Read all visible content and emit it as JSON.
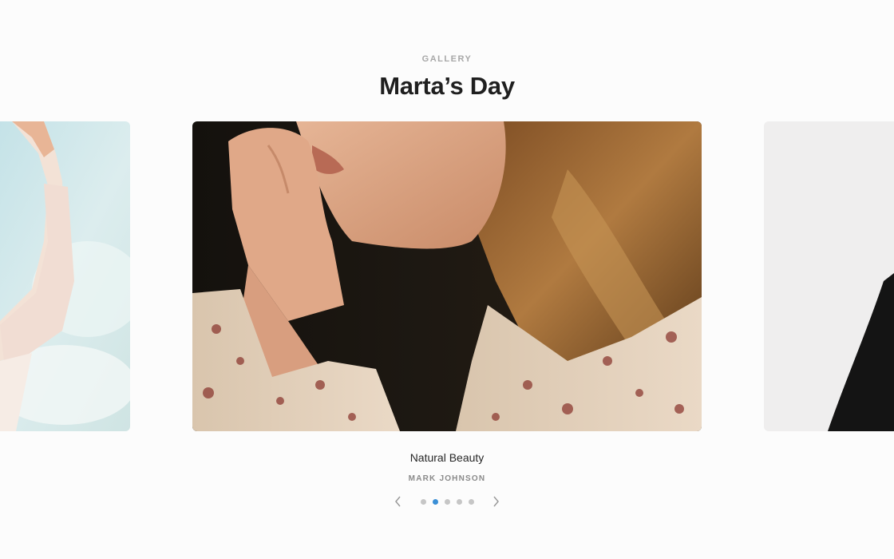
{
  "header": {
    "eyebrow": "GALLERY",
    "title": "Marta’s Day"
  },
  "slides": [
    {
      "id": "prev",
      "state": "previous"
    },
    {
      "id": "current",
      "state": "active"
    },
    {
      "id": "next",
      "state": "next"
    }
  ],
  "caption": {
    "title": "Natural Beauty",
    "author": "MARK JOHNSON"
  },
  "pagination": {
    "total": 5,
    "active_index": 1,
    "prev_icon": "chevron-left-icon",
    "next_icon": "chevron-right-icon"
  },
  "colors": {
    "background": "#fcfcfc",
    "title": "#1f1f1f",
    "dot": "#c6c6c6",
    "dot_active": "#3b8fd6"
  }
}
